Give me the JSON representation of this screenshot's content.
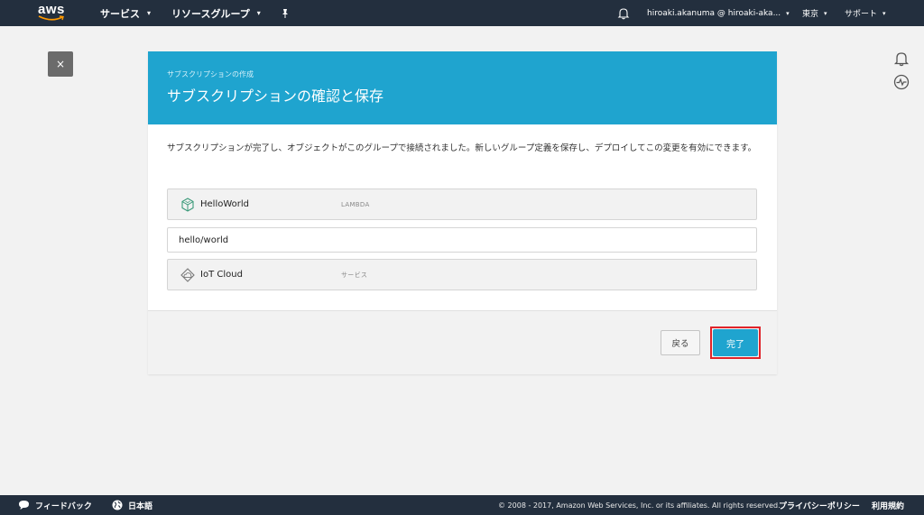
{
  "topnav": {
    "logo_text": "aws",
    "services_label": "サービス",
    "resource_groups_label": "リソースグループ",
    "user_label": "hiroaki.akanuma @ hiroaki-aka...",
    "region_label": "東京",
    "support_label": "サポート",
    "caret": "▾"
  },
  "close_button": {
    "label": "×"
  },
  "card": {
    "breadcrumb": "サブスクリプションの作成",
    "title": "サブスクリプションの確認と保存",
    "description": "サブスクリプションが完了し、オブジェクトがこのグループで接続されました。新しいグループ定義を保存し、デプロイしてこの変更を有効にできます。",
    "source": {
      "name": "HelloWorld",
      "type": "LAMBDA",
      "icon": "lambda-cube-icon"
    },
    "topic": {
      "value": "hello/world"
    },
    "target": {
      "name": "IoT Cloud",
      "type": "サービス",
      "icon": "iot-cloud-icon"
    },
    "back_label": "戻る",
    "done_label": "完了"
  },
  "footer": {
    "feedback_label": "フィードバック",
    "language_label": "日本語",
    "copyright": "© 2008 - 2017, Amazon Web Services, Inc. or its affiliates. All rights reserved.",
    "privacy_label": "プライバシーポリシー",
    "terms_label": "利用規約"
  },
  "colors": {
    "nav_bg": "#232f3e",
    "header_blue": "#1fa4cf",
    "highlight_red": "#e0242a",
    "page_bg": "#f2f2f2"
  }
}
